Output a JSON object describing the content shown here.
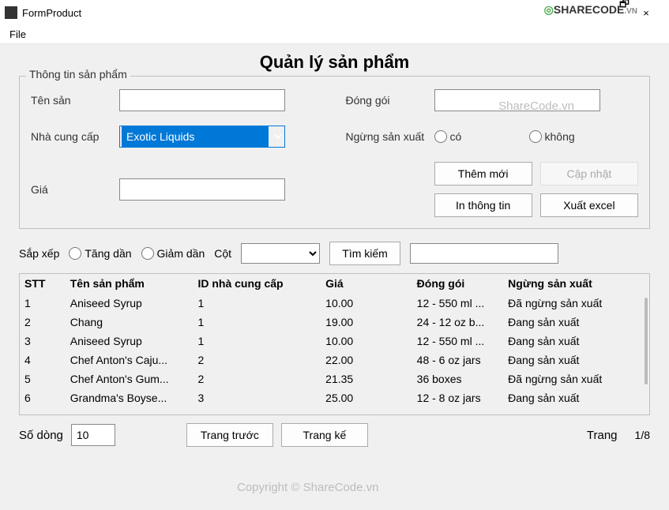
{
  "window": {
    "title": "FormProduct",
    "logo_text": "SHARECODE",
    "logo_suffix": ".VN",
    "close": "×",
    "restore": "🗗"
  },
  "menubar": {
    "file": "File"
  },
  "page": {
    "title": "Quản lý sản phẩm"
  },
  "group": {
    "legend": "Thông tin sản phẩm",
    "labels": {
      "ten_san": "Tên sản",
      "dong_goi": "Đóng gói",
      "nha_cung_cap": "Nhà cung cấp",
      "ngung_san_xuat": "Ngừng sản xuất",
      "gia": "Giá"
    },
    "supplier_selected": "Exotic Liquids",
    "radio": {
      "co": "có",
      "khong": "không"
    },
    "buttons": {
      "them_moi": "Thêm mới",
      "cap_nhat": "Cập nhật",
      "in_thong_tin": "In thông tin",
      "xuat_excel": "Xuất excel"
    },
    "values": {
      "ten_san": "",
      "dong_goi": "",
      "gia": ""
    }
  },
  "sort": {
    "label": "Sắp xếp",
    "asc": "Tăng dần",
    "desc": "Giảm dần",
    "col_label": "Cột",
    "col_selected": "",
    "search_btn": "Tìm kiếm",
    "search_value": ""
  },
  "table": {
    "headers": {
      "stt": "STT",
      "ten": "Tên sản phẩm",
      "id": "ID nhà cung cấp",
      "gia": "Giá",
      "dong_goi": "Đóng gói",
      "ngung": "Ngừng sản xuất"
    },
    "rows": [
      {
        "stt": "1",
        "ten": "Aniseed Syrup",
        "id": "1",
        "gia": "10.00",
        "dong_goi": "12 - 550 ml ...",
        "ngung": "Đã ngừng sản xuất"
      },
      {
        "stt": "2",
        "ten": "Chang",
        "id": "1",
        "gia": "19.00",
        "dong_goi": "24 - 12 oz b...",
        "ngung": "Đang sản xuất"
      },
      {
        "stt": "3",
        "ten": "Aniseed Syrup",
        "id": "1",
        "gia": "10.00",
        "dong_goi": "12 - 550 ml ...",
        "ngung": "Đang sản xuất"
      },
      {
        "stt": "4",
        "ten": "Chef Anton's Caju...",
        "id": "2",
        "gia": "22.00",
        "dong_goi": "48 - 6 oz jars",
        "ngung": "Đang sản xuất"
      },
      {
        "stt": "5",
        "ten": "Chef Anton's Gum...",
        "id": "2",
        "gia": "21.35",
        "dong_goi": "36 boxes",
        "ngung": "Đã ngừng sản xuất"
      },
      {
        "stt": "6",
        "ten": "Grandma's Boyse...",
        "id": "3",
        "gia": "25.00",
        "dong_goi": "12 - 8 oz jars",
        "ngung": "Đang sản xuất"
      }
    ]
  },
  "pager": {
    "rows_label": "Số dòng",
    "rows_value": "10",
    "prev": "Trang trước",
    "next": "Trang kế",
    "page_label": "Trang",
    "page_value": "1/8"
  },
  "watermarks": {
    "top": "ShareCode.vn",
    "bottom": "Copyright © ShareCode.vn"
  }
}
